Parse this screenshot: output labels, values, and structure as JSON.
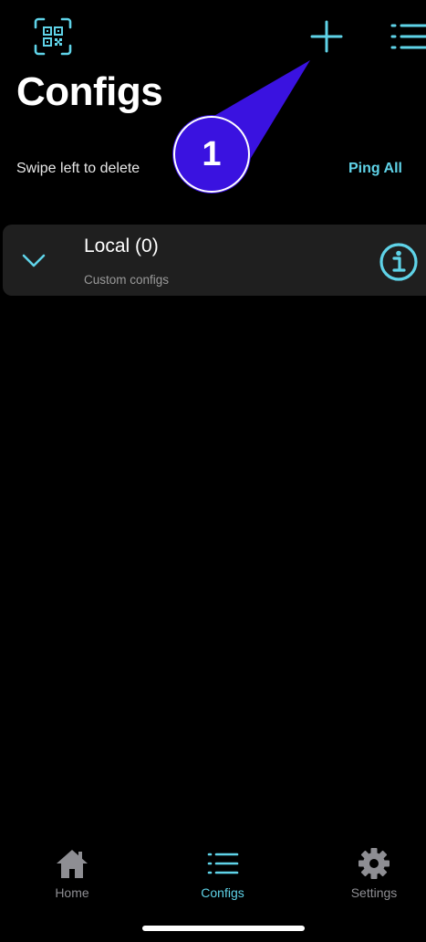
{
  "header": {
    "title": "Configs",
    "qr_icon": "qr-code-icon",
    "add_icon": "plus-icon",
    "list_icon": "list-icon"
  },
  "toolbar": {
    "hint": "Swipe left to delete",
    "ping_all": "Ping All"
  },
  "groups": [
    {
      "title": "Local (0)",
      "subtitle": "Custom configs",
      "expand_icon": "chevron-down-icon",
      "info_icon": "info-icon"
    }
  ],
  "annotation": {
    "badge_number": "1"
  },
  "tabbar": {
    "items": [
      {
        "label": "Home",
        "icon": "home-icon",
        "active": false
      },
      {
        "label": "Configs",
        "icon": "list-icon",
        "active": true
      },
      {
        "label": "Settings",
        "icon": "gear-icon",
        "active": false
      }
    ]
  },
  "colors": {
    "accent": "#5fd3e8",
    "background": "#000000",
    "card": "#1f1f1f",
    "inactive_tab": "#8e8e93",
    "annotation": "#3a12e0"
  }
}
